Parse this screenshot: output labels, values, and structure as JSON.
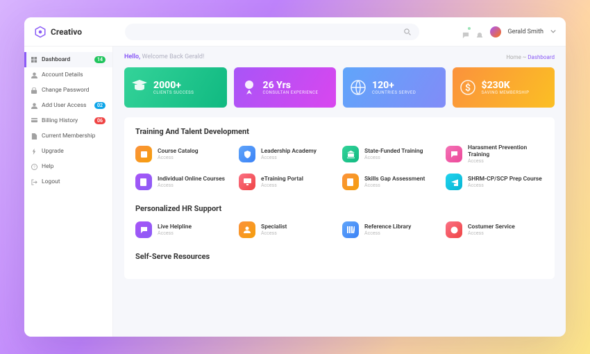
{
  "brand": "Creativo",
  "user": {
    "name": "Gerald Smith"
  },
  "header": {
    "hello_bold": "Hello,",
    "hello_rest": "Welcome Back Gerald!",
    "crumb_home": "Home",
    "crumb_current": "Dashboard",
    "crumb_sep": "~"
  },
  "sidebar": {
    "items": [
      {
        "label": "Dashboard",
        "icon": "grid-icon",
        "active": true,
        "badge": "14",
        "badge_color": "green"
      },
      {
        "label": "Account Details",
        "icon": "user-icon"
      },
      {
        "label": "Change Password",
        "icon": "lock-icon"
      },
      {
        "label": "Add User Access",
        "icon": "user-plus-icon",
        "badge": "02",
        "badge_color": "blue"
      },
      {
        "label": "Billing History",
        "icon": "card-icon",
        "badge": "06",
        "badge_color": "red"
      },
      {
        "label": "Current Membership",
        "icon": "file-icon"
      },
      {
        "label": "Upgrade",
        "icon": "bolt-icon"
      },
      {
        "label": "Help",
        "icon": "help-icon"
      },
      {
        "label": "Logout",
        "icon": "logout-icon"
      }
    ]
  },
  "stats": [
    {
      "value": "2000+",
      "label": "CLIENTS SUCCESS",
      "icon": "grad-icon",
      "gradient": "g1"
    },
    {
      "value": "26 Yrs",
      "label": "CONSULTAN EXPERIENCE",
      "icon": "ribbon-icon",
      "gradient": "g2"
    },
    {
      "value": "120+",
      "label": "COUNTRIES SERVED",
      "icon": "globe-icon",
      "gradient": "g3"
    },
    {
      "value": "$230K",
      "label": "SAVING MEMBERSHIP",
      "icon": "money-icon",
      "gradient": "g4"
    }
  ],
  "sections": [
    {
      "title": "Training And Talent Development",
      "items": [
        {
          "name": "Course Catalog",
          "sub": "Access",
          "icon": "book-icon",
          "color": "gc-orange"
        },
        {
          "name": "Leadership Academy",
          "sub": "Access",
          "icon": "shield-icon",
          "color": "gc-blue"
        },
        {
          "name": "State-Funded Training",
          "sub": "Access",
          "icon": "bank-icon",
          "color": "gc-green"
        },
        {
          "name": "Harasment Prevention Training",
          "sub": "Access",
          "icon": "chat-icon",
          "color": "gc-pink"
        },
        {
          "name": "Individual Online Courses",
          "sub": "Access",
          "icon": "page-icon",
          "color": "gc-purple"
        },
        {
          "name": "eTraining Portal",
          "sub": "Access",
          "icon": "monitor-icon",
          "color": "gc-red"
        },
        {
          "name": "Skills Gap Assessment",
          "sub": "Access",
          "icon": "doc-icon",
          "color": "gc-orange"
        },
        {
          "name": "SHRM-CP/SCP Prep Course",
          "sub": "Access",
          "icon": "grad-icon",
          "color": "gc-cyan"
        }
      ]
    },
    {
      "title": "Personalized HR Support",
      "items": [
        {
          "name": "Live Helpline",
          "sub": "Access",
          "icon": "chat-icon",
          "color": "gc-purple"
        },
        {
          "name": "Specialist",
          "sub": "Access",
          "icon": "user-icon",
          "color": "gc-orange"
        },
        {
          "name": "Reference Library",
          "sub": "Access",
          "icon": "lib-icon",
          "color": "gc-blue"
        },
        {
          "name": "Costumer Service",
          "sub": "Access",
          "icon": "support-icon",
          "color": "gc-red"
        }
      ]
    },
    {
      "title": "Self-Serve Resources",
      "items": []
    }
  ]
}
